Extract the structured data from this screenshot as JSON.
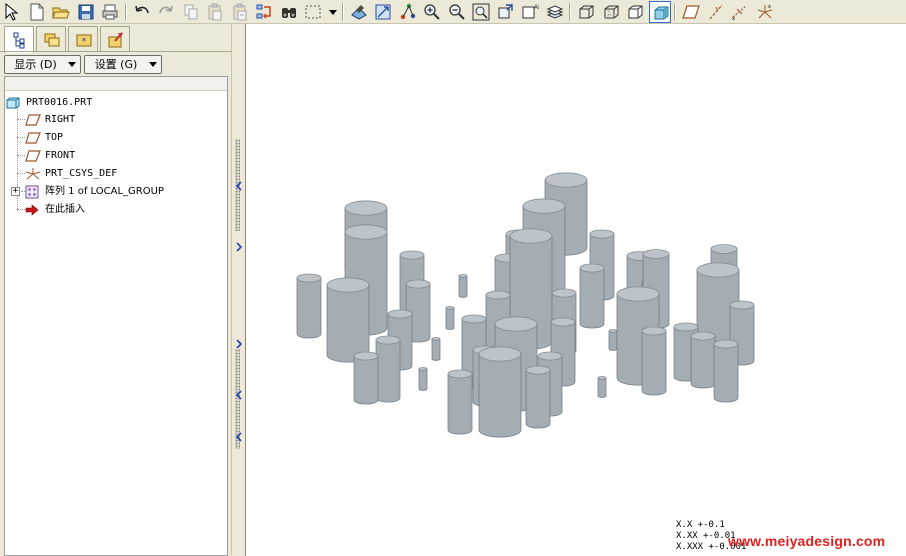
{
  "toolbar": {
    "groups": [
      [
        "pointer-icon",
        "new-file-icon",
        "open-folder-icon",
        "save-icon",
        "print-icon"
      ],
      [
        "undo-icon",
        "redo-icon",
        "copy-icon",
        "paste-icon",
        "paste-special-icon",
        "regenerate-icon",
        "find-icon",
        "select-box-icon",
        "dropdown-arrow-icon"
      ],
      [
        "repaint-icon",
        "orient-icon",
        "spin-center-icon",
        "zoom-in-icon",
        "zoom-out-icon",
        "refit-icon",
        "reorient-icon",
        "saved-views-icon",
        "layers-icon"
      ],
      [
        "wireframe-icon",
        "hidden-line-icon",
        "no-hidden-icon",
        "shaded-icon"
      ],
      [
        "datum-planes-icon",
        "datum-axes-icon",
        "datum-points-icon",
        "csys-icon"
      ]
    ],
    "active": "shaded-icon"
  },
  "panel": {
    "tabs": [
      "model-tree-icon",
      "folder-browser-icon",
      "favorites-icon",
      "connections-icon"
    ],
    "selected_tab": "model-tree-icon",
    "show_button": "显示 (D)",
    "settings_button": "设置 (G)"
  },
  "tree": {
    "root": "PRT0016.PRT",
    "items": [
      {
        "label": "RIGHT",
        "icon": "datum-plane-icon"
      },
      {
        "label": "TOP",
        "icon": "datum-plane-icon"
      },
      {
        "label": "FRONT",
        "icon": "datum-plane-icon"
      },
      {
        "label": "PRT_CSYS_DEF",
        "icon": "csys-icon"
      },
      {
        "label": "阵列 1 of LOCAL_GROUP",
        "icon": "pattern-icon",
        "expandable": true
      },
      {
        "label": "在此插入",
        "icon": "insert-here-icon"
      }
    ]
  },
  "viewport": {
    "tolerance_lines": [
      "X.X    +-0.1",
      "X.XX   +-0.01",
      "X.XXX  +-0.001"
    ],
    "watermark": "www.meiyadesign.com"
  },
  "colors": {
    "cylinder_body": "#a4adb3",
    "cylinder_top": "#bcc4c9",
    "watermark": "#e02020",
    "panel_bg": "#ece9d8"
  }
}
